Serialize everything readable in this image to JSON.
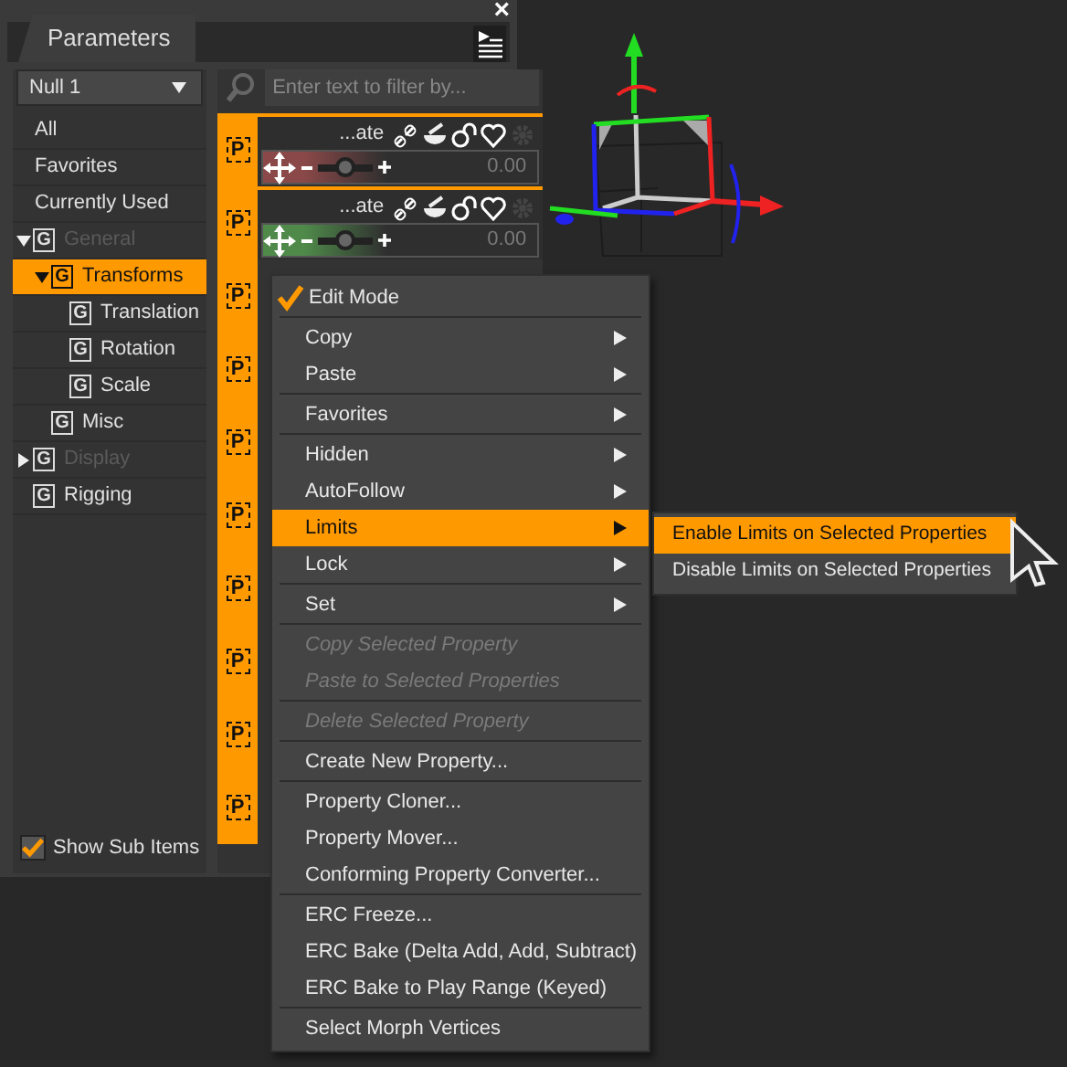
{
  "panel": {
    "tab": "Parameters",
    "close": "×",
    "node_select": "Null 1",
    "filter_placeholder": "Enter text to filter by...",
    "views": [
      {
        "label": "All",
        "selected": false
      },
      {
        "label": "Favorites",
        "selected": false
      },
      {
        "label": "Currently Used",
        "selected": false
      }
    ],
    "tree": [
      {
        "badge": "G",
        "label": "General",
        "expanded": true,
        "disabled": true,
        "selected": false,
        "children": [
          {
            "badge": "G",
            "label": "Transforms",
            "expanded": true,
            "disabled": false,
            "selected": true,
            "children": [
              {
                "badge": "G",
                "label": "Translation",
                "disabled": false,
                "selected": false
              },
              {
                "badge": "G",
                "label": "Rotation",
                "disabled": false,
                "selected": false
              },
              {
                "badge": "G",
                "label": "Scale",
                "disabled": false,
                "selected": false
              }
            ]
          },
          {
            "badge": "G",
            "label": "Misc",
            "disabled": false,
            "selected": false
          }
        ]
      },
      {
        "badge": "G",
        "label": "Display",
        "expanded": false,
        "disabled": true,
        "selected": false
      },
      {
        "badge": "G",
        "label": "Rigging",
        "disabled": false,
        "selected": false
      }
    ],
    "show_sub_items": {
      "label": "Show Sub Items",
      "checked": true
    },
    "properties": [
      {
        "kind": "full",
        "badge": "P",
        "name": "...ate",
        "value": "0.00",
        "level": 0.5,
        "color": "#8a4848"
      },
      {
        "kind": "full",
        "badge": "P",
        "name": "...ate",
        "value": "0.00",
        "level": 0.5,
        "color": "#4f8a4a"
      },
      {
        "kind": "icon",
        "badge": "P"
      },
      {
        "kind": "icon",
        "badge": "P"
      },
      {
        "kind": "icon",
        "badge": "P"
      },
      {
        "kind": "icon",
        "badge": "P"
      },
      {
        "kind": "icon",
        "badge": "P"
      },
      {
        "kind": "icon",
        "badge": "P"
      },
      {
        "kind": "icon",
        "badge": "P"
      },
      {
        "kind": "icon",
        "badge": "P"
      }
    ]
  },
  "context_menu": [
    {
      "kind": "check",
      "label": "Edit Mode",
      "checked": true
    },
    {
      "kind": "separator"
    },
    {
      "kind": "item",
      "label": "Copy",
      "has_submenu": true,
      "disabled": false,
      "selected": false
    },
    {
      "kind": "item",
      "label": "Paste",
      "has_submenu": true,
      "disabled": false,
      "selected": false
    },
    {
      "kind": "separator"
    },
    {
      "kind": "item",
      "label": "Favorites",
      "has_submenu": true,
      "disabled": false,
      "selected": false
    },
    {
      "kind": "separator"
    },
    {
      "kind": "item",
      "label": "Hidden",
      "has_submenu": true,
      "disabled": false,
      "selected": false
    },
    {
      "kind": "item",
      "label": "AutoFollow",
      "has_submenu": true,
      "disabled": false,
      "selected": false
    },
    {
      "kind": "item",
      "label": "Limits",
      "has_submenu": true,
      "disabled": false,
      "selected": true,
      "submenu": [
        {
          "label": "Enable Limits on Selected Properties",
          "selected": true
        },
        {
          "label": "Disable Limits on Selected Properties",
          "selected": false
        }
      ]
    },
    {
      "kind": "item",
      "label": "Lock",
      "has_submenu": true,
      "disabled": false,
      "selected": false
    },
    {
      "kind": "separator"
    },
    {
      "kind": "item",
      "label": "Set",
      "has_submenu": true,
      "disabled": false,
      "selected": false
    },
    {
      "kind": "separator"
    },
    {
      "kind": "item",
      "label": "Copy Selected Property",
      "has_submenu": false,
      "disabled": true,
      "selected": false
    },
    {
      "kind": "item",
      "label": "Paste to Selected Properties",
      "has_submenu": false,
      "disabled": true,
      "selected": false
    },
    {
      "kind": "separator"
    },
    {
      "kind": "item",
      "label": "Delete Selected Property",
      "has_submenu": false,
      "disabled": true,
      "selected": false
    },
    {
      "kind": "separator"
    },
    {
      "kind": "item",
      "label": "Create New Property...",
      "has_submenu": false,
      "disabled": false,
      "selected": false
    },
    {
      "kind": "separator"
    },
    {
      "kind": "item",
      "label": "Property Cloner...",
      "has_submenu": false,
      "disabled": false,
      "selected": false
    },
    {
      "kind": "item",
      "label": "Property Mover...",
      "has_submenu": false,
      "disabled": false,
      "selected": false
    },
    {
      "kind": "item",
      "label": "Conforming Property Converter...",
      "has_submenu": false,
      "disabled": false,
      "selected": false
    },
    {
      "kind": "separator"
    },
    {
      "kind": "item",
      "label": "ERC Freeze...",
      "has_submenu": false,
      "disabled": false,
      "selected": false
    },
    {
      "kind": "item",
      "label": "ERC Bake (Delta Add, Add, Subtract)",
      "has_submenu": false,
      "disabled": false,
      "selected": false
    },
    {
      "kind": "item",
      "label": "ERC Bake to Play Range (Keyed)",
      "has_submenu": false,
      "disabled": false,
      "selected": false
    },
    {
      "kind": "separator"
    },
    {
      "kind": "item",
      "label": "Select Morph Vertices",
      "has_submenu": false,
      "disabled": false,
      "selected": false
    }
  ]
}
